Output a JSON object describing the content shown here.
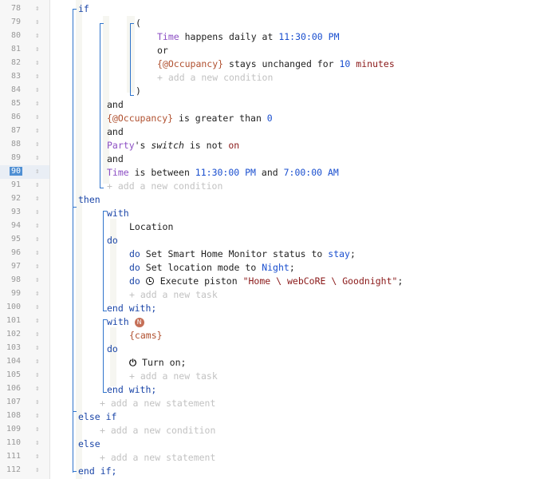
{
  "gutter": {
    "line_numbers": [
      "78",
      "79",
      "80",
      "81",
      "82",
      "83",
      "84",
      "85",
      "86",
      "87",
      "88",
      "89",
      "90",
      "91",
      "92",
      "93",
      "94",
      "95",
      "96",
      "97",
      "98",
      "99",
      "100",
      "101",
      "102",
      "103",
      "104",
      "105",
      "106",
      "107",
      "108",
      "109",
      "110",
      "111",
      "112"
    ],
    "active_line": "90",
    "grip_glyph": "⇕"
  },
  "code": {
    "l78_if": "if",
    "l79_open_paren": "(",
    "l80_subject": "Time",
    "l80_text": " happens daily at ",
    "l80_time": "11:30:00 PM",
    "l81_or": "or",
    "l82_subject": "{@Occupancy}",
    "l82_text": " stays unchanged for ",
    "l82_num": "10",
    "l82_unit": "minutes",
    "l83_add": "+ add a new condition",
    "l84_close_paren": ")",
    "l85_and": "and",
    "l86_subject": "{@Occupancy}",
    "l86_text": " is greater than ",
    "l86_num": "0",
    "l87_and": "and",
    "l88_device": "Party",
    "l88_text": "'s ",
    "l88_attr": "switch",
    "l88_text2": " is not ",
    "l88_value": "on",
    "l89_and": "and",
    "l90_subject": "Time",
    "l90_text": " is between ",
    "l90_time1": "11:30:00 PM",
    "l90_and": " and ",
    "l90_time2": "7:00:00 AM",
    "l91_add": "+ add a new condition",
    "l92_then": "then",
    "l93_with": "with",
    "l94_location": "Location",
    "l95_do": "do",
    "l96_do": "do",
    "l96_text": " Set Smart Home Monitor status to ",
    "l96_value": "stay",
    "l96_semi": ";",
    "l97_do": "do",
    "l97_text": " Set location mode to ",
    "l97_value": "Night",
    "l97_semi": ";",
    "l98_do": "do",
    "l98_text": " Execute piston ",
    "l98_value": "\"Home \\ webCoRE \\ Goodnight\"",
    "l98_semi": ";",
    "l99_add": "+ add a new task",
    "l100_end": "end with;",
    "l101_with": "with",
    "l101_badge": "N",
    "l102_var": "{cams}",
    "l103_do": "do",
    "l104_power": "⏻",
    "l104_text": " Turn on;",
    "l105_add": "+ add a new task",
    "l106_end": "end with;",
    "l107_add": "+ add a new statement",
    "l108_else_if": "else if",
    "l109_add": "+ add a new condition",
    "l110_else": "else",
    "l111_add": "+ add a new statement",
    "l112_end_if": "end if;"
  },
  "colors": {
    "keyword": "#1b46a8",
    "entity": "#8c4fc4",
    "variable": "#b0502f",
    "number": "#1a4fcf",
    "string": "#8b1a1a",
    "ghost": "#c2c2c2",
    "bracket": "#2f74cc"
  }
}
